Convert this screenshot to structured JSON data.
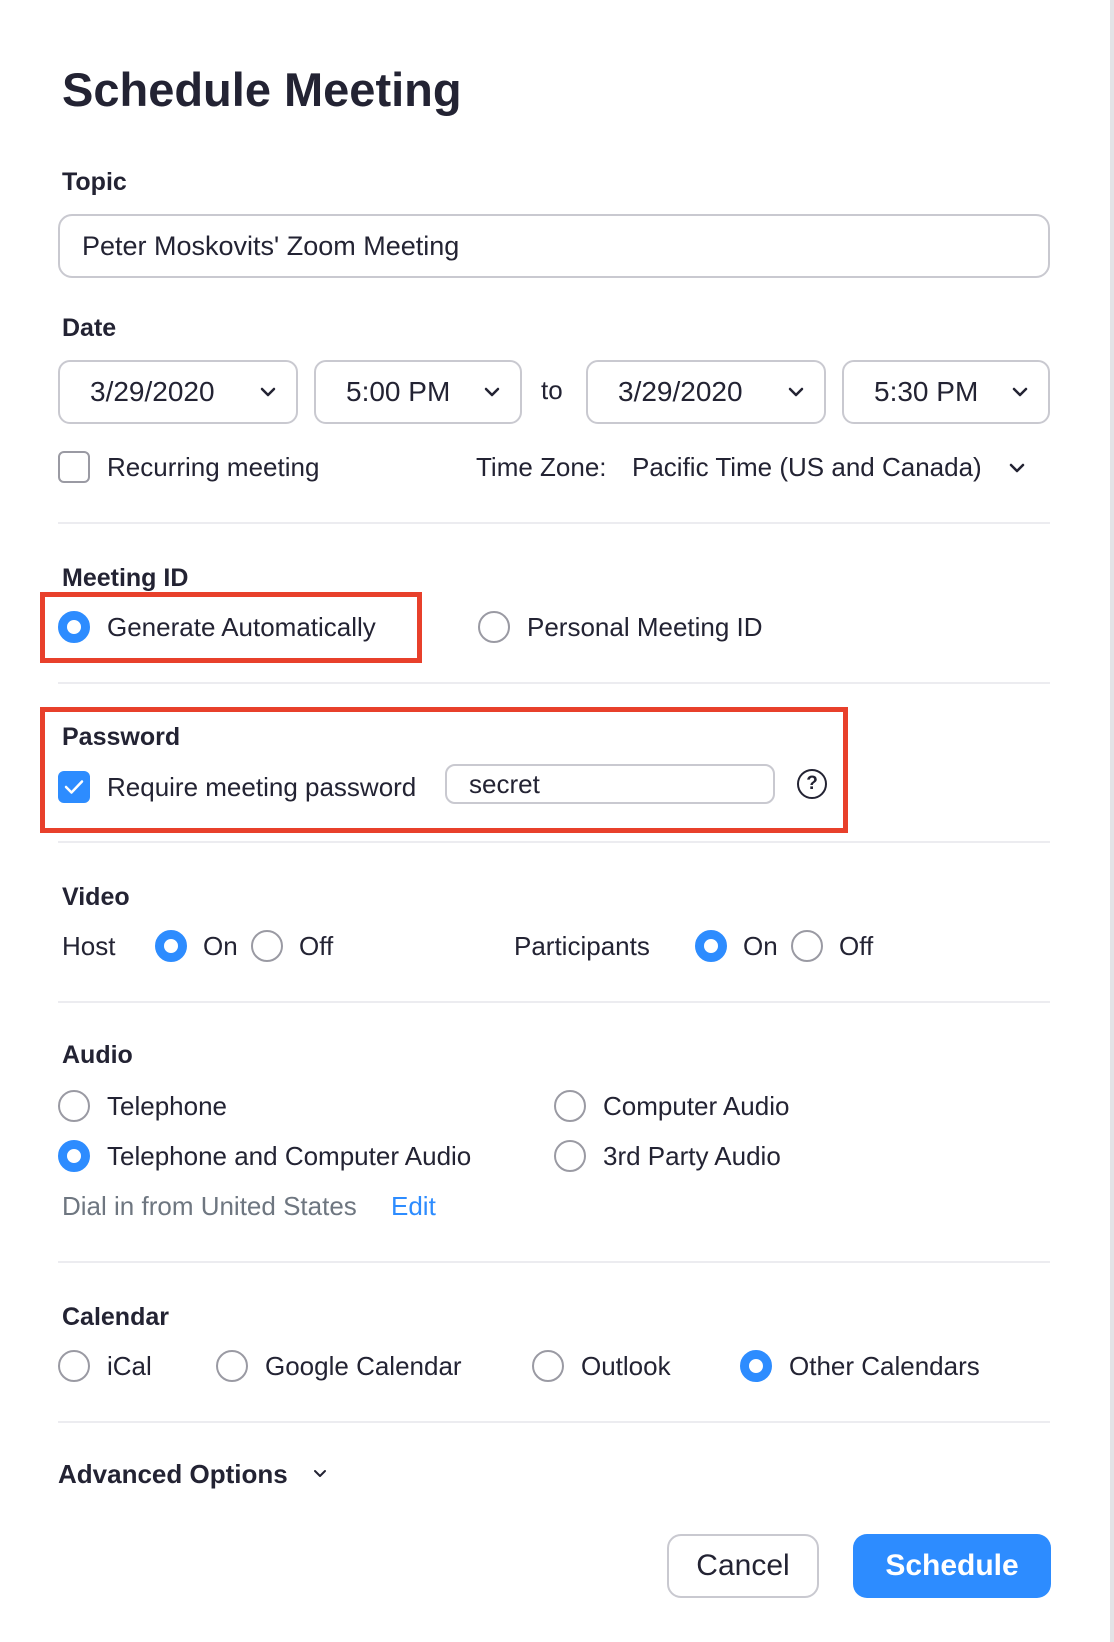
{
  "title": "Schedule Meeting",
  "topic": {
    "label": "Topic",
    "value": "Peter Moskovits' Zoom Meeting"
  },
  "date": {
    "label": "Date",
    "start_date": "3/29/2020",
    "start_time": "5:00 PM",
    "to_label": "to",
    "end_date": "3/29/2020",
    "end_time": "5:30 PM"
  },
  "recurring": {
    "label": "Recurring meeting",
    "checked": false
  },
  "timezone": {
    "label": "Time Zone:",
    "value": "Pacific Time (US and Canada)"
  },
  "meeting_id": {
    "label": "Meeting ID",
    "options": [
      "Generate Automatically",
      "Personal Meeting ID"
    ],
    "selected": "Generate Automatically"
  },
  "password": {
    "label": "Password",
    "require_label": "Require meeting password",
    "checked": true,
    "value": "secret",
    "help": "?"
  },
  "video": {
    "label": "Video",
    "host_label": "Host",
    "participants_label": "Participants",
    "on": "On",
    "off": "Off",
    "host": "On",
    "participants": "On"
  },
  "audio": {
    "label": "Audio",
    "options": [
      "Telephone",
      "Computer Audio",
      "Telephone and Computer Audio",
      "3rd Party Audio"
    ],
    "selected": "Telephone and Computer Audio",
    "dial_in": "Dial in from United States",
    "edit": "Edit"
  },
  "calendar": {
    "label": "Calendar",
    "options": [
      "iCal",
      "Google Calendar",
      "Outlook",
      "Other Calendars"
    ],
    "selected": "Other Calendars"
  },
  "advanced_options": "Advanced Options",
  "buttons": {
    "cancel": "Cancel",
    "schedule": "Schedule"
  },
  "colors": {
    "accent": "#2d8cff",
    "highlight": "#e8402b",
    "text": "#232333"
  }
}
